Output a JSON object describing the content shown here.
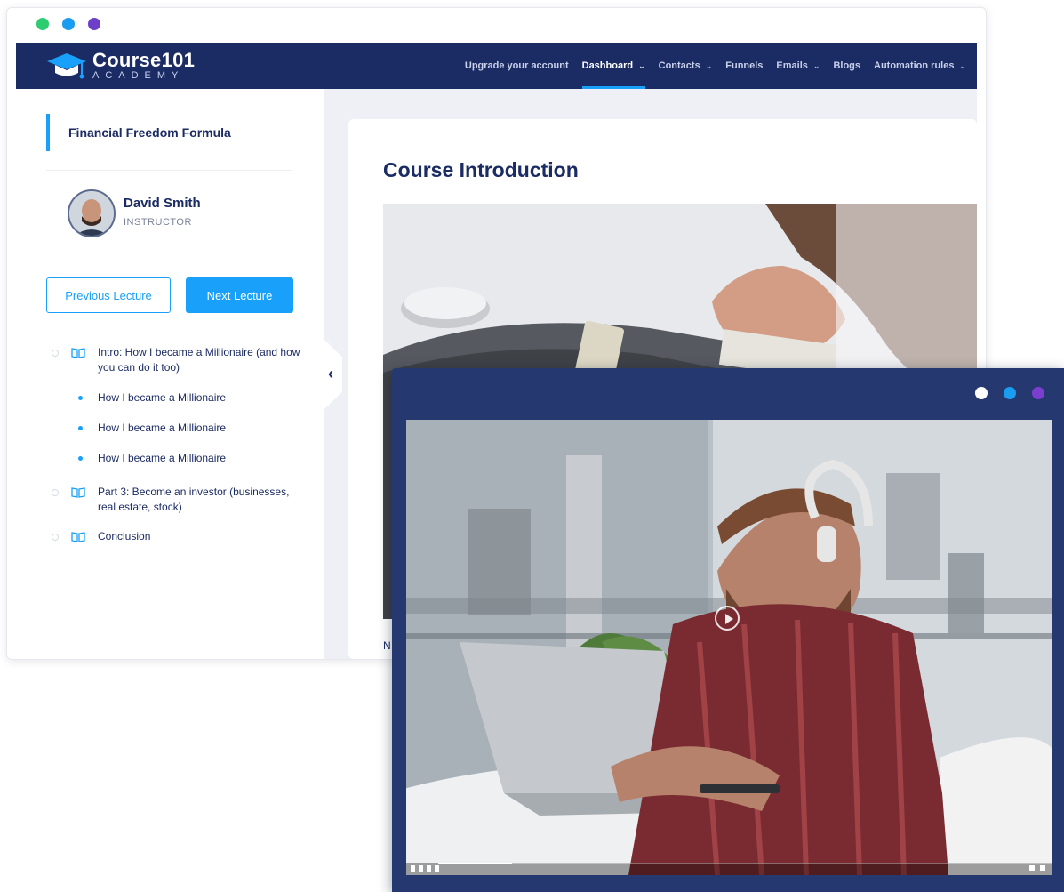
{
  "window_dots": {
    "green": "#2ecc71",
    "blue": "#1a9cf0",
    "purple": "#6c3fc9"
  },
  "front_dots": {
    "white": "#ffffff",
    "blue": "#1a9cf0",
    "purple": "#7b3fd0"
  },
  "brand": {
    "title": "Course101",
    "subtitle": "ACADEMY"
  },
  "nav": {
    "items": [
      {
        "label": "Upgrade your account",
        "chevron": false,
        "active": false
      },
      {
        "label": "Dashboard",
        "chevron": true,
        "active": true
      },
      {
        "label": "Contacts",
        "chevron": true,
        "active": false
      },
      {
        "label": "Funnels",
        "chevron": false,
        "active": false
      },
      {
        "label": "Emails",
        "chevron": true,
        "active": false
      },
      {
        "label": "Blogs",
        "chevron": false,
        "active": false
      },
      {
        "label": "Automation rules",
        "chevron": true,
        "active": false
      }
    ]
  },
  "sidebar": {
    "course_title": "Financial Freedom Formula",
    "instructor": {
      "name": "David Smith",
      "role": "INSTRUCTOR"
    },
    "prev_label": "Previous Lecture",
    "next_label": "Next Lecture",
    "lessons": [
      {
        "type": "section",
        "text": "Intro: How I became a Millionaire (and how you can do it too)"
      },
      {
        "type": "item",
        "text": "How I became a Millionaire"
      },
      {
        "type": "item",
        "text": "How I became a Millionaire"
      },
      {
        "type": "item",
        "text": "How I became a Millionaire"
      },
      {
        "type": "section",
        "text": "Part 3: Become an investor (businesses, real estate, stock)"
      },
      {
        "type": "section",
        "text": "Conclusion"
      }
    ]
  },
  "main": {
    "title": "Course Introduction",
    "partial_text": "N"
  },
  "video": {
    "progress": 0.12
  },
  "colors": {
    "header": "#1b2b63",
    "accent": "#18a0fb",
    "front_bg": "#25386f"
  }
}
